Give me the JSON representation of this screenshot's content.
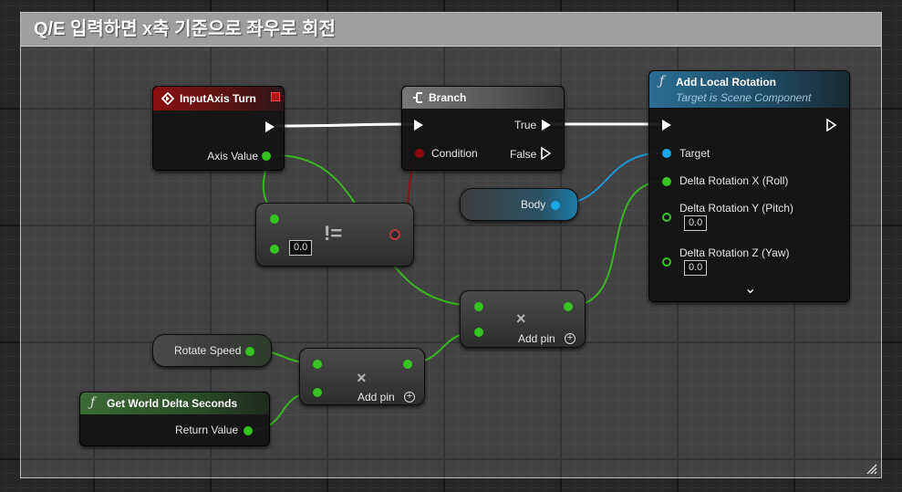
{
  "comment": {
    "title": "Q/E 입력하면 x축 기준으로 좌우로 회전"
  },
  "input_axis_node": {
    "title": "InputAxis Turn",
    "axis_value": "Axis Value"
  },
  "branch_node": {
    "title": "Branch",
    "condition": "Condition",
    "true_label": "True",
    "false_label": "False"
  },
  "not_equal_node": {
    "operator": "!=",
    "default_value": "0.0"
  },
  "add_local_rotation_node": {
    "title": "Add Local Rotation",
    "subtitle": "Target is Scene Component",
    "target": "Target",
    "delta_x": "Delta Rotation X (Roll)",
    "delta_y": "Delta Rotation Y (Pitch)",
    "delta_y_value": "0.0",
    "delta_z": "Delta Rotation Z (Yaw)",
    "delta_z_value": "0.0",
    "expand_glyph": "⌄"
  },
  "body_node": {
    "label": "Body"
  },
  "multiply_node_1": {
    "operator": "×",
    "add_pin": "Add pin"
  },
  "multiply_node_2": {
    "operator": "×",
    "add_pin": "Add pin"
  },
  "rotate_speed_node": {
    "label": "Rotate Speed"
  },
  "world_delta_node": {
    "title": "Get World Delta Seconds",
    "return_value": "Return Value"
  },
  "glyphs": {
    "function": "ƒ",
    "add": "+"
  },
  "colors": {
    "exec_wire": "#ffffff",
    "float_wire": "#38b81e",
    "bool_wire": "#8f1515",
    "object_wire": "#1a97d4",
    "event_header": "#7a0d0d",
    "function_header": "#1f5a78",
    "pure_function_header": "#2e5c2a"
  }
}
